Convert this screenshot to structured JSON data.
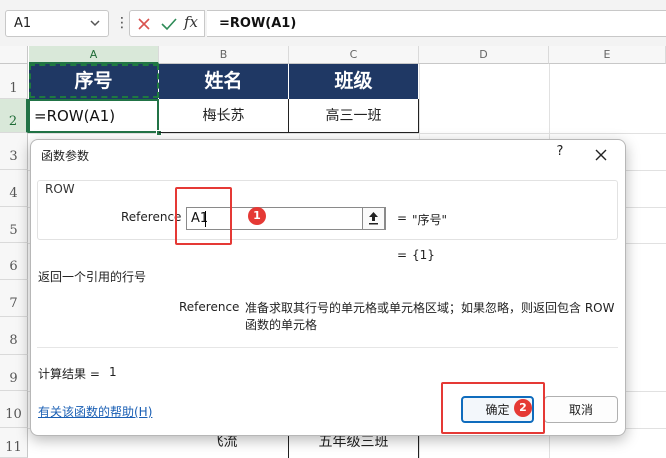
{
  "formula_bar": {
    "name_box": "A1",
    "dots": "⋮",
    "fx": "fx",
    "formula": "=ROW(A1)"
  },
  "sheet": {
    "columns": [
      "A",
      "B",
      "C",
      "D",
      "E"
    ],
    "rows": [
      "1",
      "2",
      "3",
      "4",
      "5",
      "6",
      "7",
      "8",
      "9",
      "10",
      "11"
    ],
    "header_row": [
      "序号",
      "姓名",
      "班级"
    ],
    "row2": [
      "=ROW(A1)",
      "梅长苏",
      "高三一班"
    ],
    "row11": [
      "",
      "飞流",
      "五年级三班"
    ],
    "header_color": "#1f3864",
    "selection_color": "#217346"
  },
  "dialog": {
    "title": "函数参数",
    "help": "?",
    "function_name": "ROW",
    "arg_label": "Reference",
    "arg_input": "A1",
    "arg_eq": "=",
    "arg_value": "\"序号\"",
    "result_eq": "=",
    "result_value": "{1}",
    "function_description": "返回一个引用的行号",
    "arg_help_name": "Reference",
    "arg_help_text": "准备求取其行号的单元格或单元格区域；如果忽略，则返回包含 ROW 函数的单元格",
    "calc_label": "计算结果 =",
    "calc_value": "1",
    "help_link": "有关该函数的帮助(H)",
    "ok_label": "确定",
    "cancel_label": "取消"
  },
  "annotations": {
    "badge1": "1",
    "badge2": "2",
    "color": "#e53935"
  }
}
